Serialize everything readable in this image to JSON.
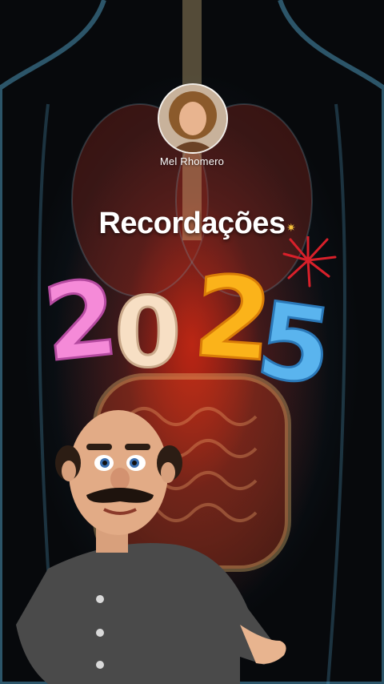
{
  "profile": {
    "username": "Mel Rhomero"
  },
  "post": {
    "title": "Recordações",
    "year_digits": [
      "2",
      "0",
      "2",
      "5"
    ]
  },
  "colors": {
    "digit_1": "#f58ad8",
    "digit_2": "#f7dfc4",
    "digit_3": "#fbb31a",
    "digit_4": "#5ab4ee",
    "firework": "#d8202a"
  }
}
